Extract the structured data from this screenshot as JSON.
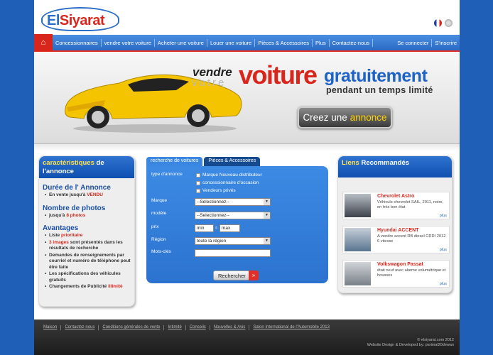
{
  "header": {
    "logo": {
      "part1": "El",
      "part2": "Siyarat"
    },
    "flags": [
      "French flag",
      "Arabic flag"
    ]
  },
  "nav": {
    "items": [
      "Concessionnaires",
      "vendre votre voiture",
      "Acheter une voiture",
      "Louer une voiture",
      "Pièces & Accessoires",
      "Plus",
      "Contactez-nous"
    ],
    "login": "Se connecter",
    "register": "S'inscrire"
  },
  "banner": {
    "line1": "vendre",
    "line2": "votre",
    "big": "voiture",
    "blue": "gratuitement",
    "sub": "pendant un temps limité",
    "cta_text": "Creez une",
    "cta_highlight": "annonce"
  },
  "left": {
    "title_hl": "caractéristiques",
    "title_rest": "de l'annonce",
    "sections": [
      {
        "heading": "Durée de l' Annonce",
        "items": [
          {
            "text": "En vente jusqu'à ",
            "hl": "VENDU"
          }
        ]
      },
      {
        "heading": "Nombre de photos",
        "items": [
          {
            "text": "jusqu'à ",
            "hl": "8 photos"
          }
        ]
      },
      {
        "heading": "Avantages",
        "items": [
          {
            "text": "Liste ",
            "hl": "prioritaire"
          },
          {
            "text": "",
            "hl": "3 images",
            "after": " sont présentés dans les résultats de recherche"
          },
          {
            "text": "Demandes de renseignements par courriel et numéro de téléphone peut être faite"
          },
          {
            "text": "Les spécifications des véhicules gratuits"
          },
          {
            "text": "Changements de Publicité ",
            "hl": "illimité"
          }
        ]
      }
    ]
  },
  "search": {
    "tab1": "recherche de voitures",
    "tab2": "Pièces & Accessoires",
    "type_label": "type d'annonce",
    "checkboxes": [
      "Marque Nouveau distributeur",
      "concessionnaire d'occasion",
      "Vendeurs privés"
    ],
    "marque_label": "Marque",
    "marque_value": "--Selectionnez--",
    "modele_label": "modèle",
    "modele_value": "--Selectionnez--",
    "prix_label": "prix",
    "min": "min",
    "to": "à",
    "max": "max",
    "region_label": "Région",
    "region_value": "toute la région",
    "mots_label": "Mots-clés",
    "mots_value": "",
    "button": "Rechercher"
  },
  "right": {
    "title_hl": "Liens",
    "title_rest": "Recommandés",
    "items": [
      {
        "name": "Chevrolet Astro",
        "desc": "Véhicule chevrolet SAIL, 2011, noire, en très bon état",
        "more": "plus"
      },
      {
        "name": "Hyundai ACCENT",
        "desc": "A vendre accent RB diesel CRDI 2012 6 vitesse",
        "more": "plus"
      },
      {
        "name": "Volkswagon Passat",
        "desc": "était neuf avec alarme volumétrique et housses",
        "more": "plus"
      }
    ]
  },
  "footer": {
    "links": [
      "Maison",
      "Contactez-nous",
      "Conditions générales de vente",
      "Intimité",
      "Conseils",
      "Nouvelles & Avis",
      "Salon International de l'Automobile 2013"
    ],
    "copyright": "© elsiyarat.com 2012",
    "credit": "Website Design & Developed by: parimal20dewan"
  },
  "colors": {
    "blue": "#2c6fc6",
    "red": "#d9261c",
    "page_bg": "#1f5fb8"
  }
}
